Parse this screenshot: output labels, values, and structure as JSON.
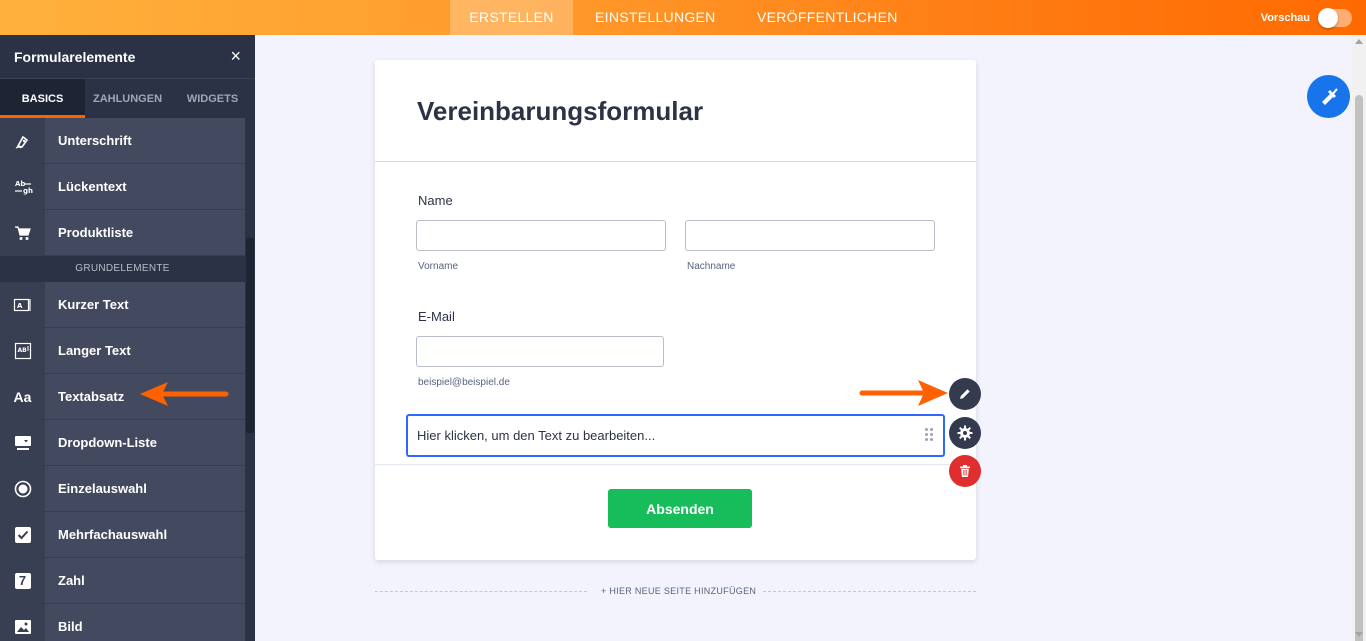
{
  "topbar": {
    "tabs": [
      "ERSTELLEN",
      "EINSTELLUNGEN",
      "VERÖFFENTLICHEN"
    ],
    "preview_label": "Vorschau",
    "active_tab": "ERSTELLEN"
  },
  "sidebar": {
    "title": "Formularelemente",
    "close_icon": "×",
    "tabs": [
      "BASICS",
      "ZAHLUNGEN",
      "WIDGETS"
    ],
    "items_top": [
      {
        "icon": "signature-pen-icon",
        "label": "Unterschrift"
      },
      {
        "icon": "fill-in-blank-icon",
        "label": "Lückentext",
        "glyph": "Ab"
      },
      {
        "icon": "cart-icon",
        "label": "Produktliste"
      }
    ],
    "section_label": "GRUNDELEMENTE",
    "items": [
      {
        "icon": "short-text-icon",
        "label": "Kurzer Text"
      },
      {
        "icon": "long-text-icon",
        "label": "Langer Text"
      },
      {
        "icon": "text-paragraph-icon",
        "label": "Textabsatz",
        "glyph": "Aa"
      },
      {
        "icon": "dropdown-icon",
        "label": "Dropdown-Liste"
      },
      {
        "icon": "radio-icon",
        "label": "Einzelauswahl"
      },
      {
        "icon": "checkbox-icon",
        "label": "Mehrfachauswahl"
      },
      {
        "icon": "number-icon",
        "label": "Zahl",
        "glyph": "7"
      },
      {
        "icon": "image-icon",
        "label": "Bild"
      }
    ]
  },
  "form": {
    "title": "Vereinbarungsformular",
    "name_label": "Name",
    "first_name_sublabel": "Vorname",
    "last_name_sublabel": "Nachname",
    "email_label": "E-Mail",
    "email_sublabel": "beispiel@beispiel.de",
    "paragraph_text": "Hier klicken, um den Text zu bearbeiten...",
    "submit_label": "Absenden",
    "add_page_label": "+ HIER NEUE SEITE HINZUFÜGEN"
  },
  "colors": {
    "accent": "#ff6100",
    "sidebar_bg": "#2b3245",
    "submit_green": "#18bd5b",
    "selection_blue": "#2e69ff",
    "delete_red": "#e02d2d",
    "paint_blue": "#1774ea"
  }
}
